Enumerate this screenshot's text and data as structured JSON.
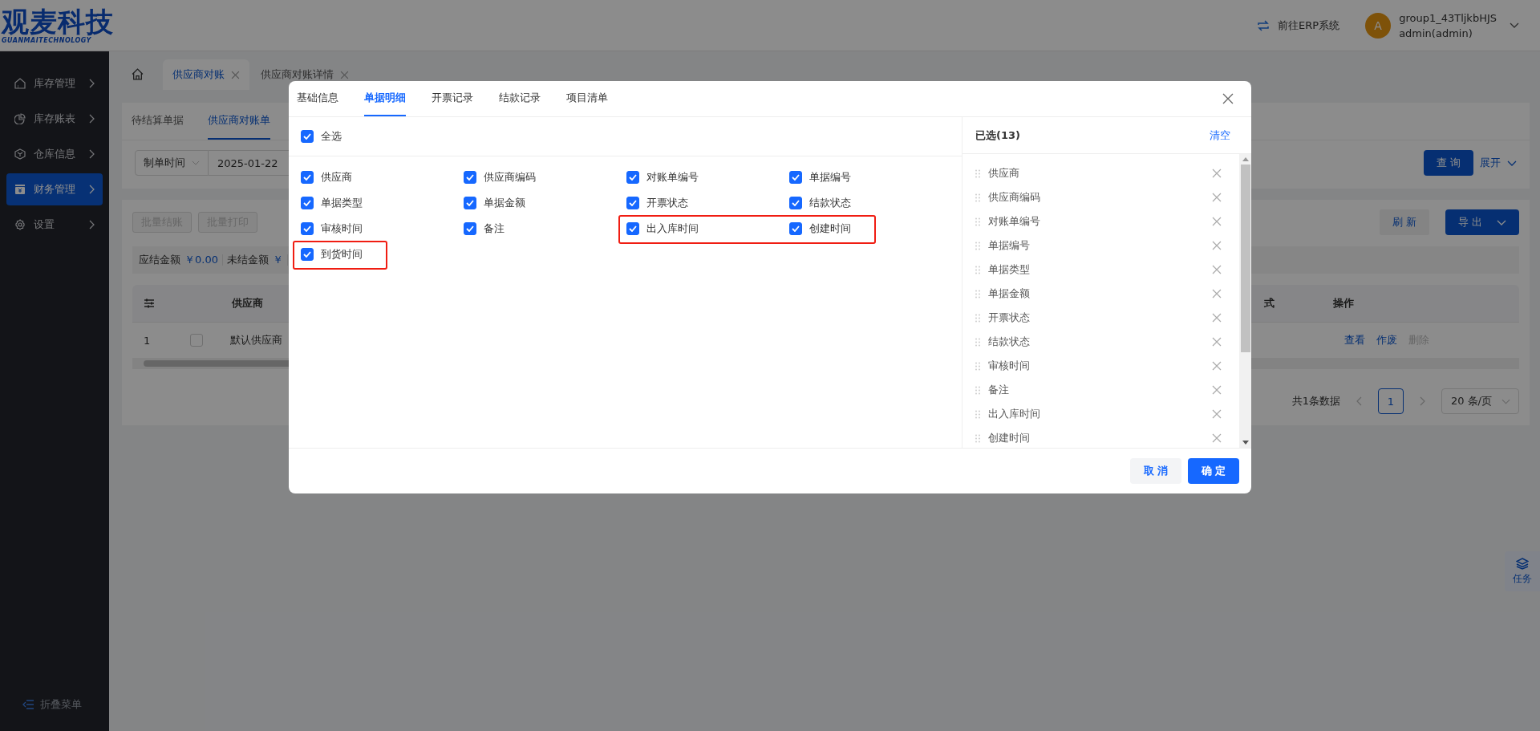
{
  "header": {
    "logo_title": "观麦科技",
    "logo_subtitle": "GUANMAITECHNOLOGY",
    "erp_link": "前往ERP系统",
    "user": {
      "avatar": "A",
      "name": "group1_43TljkbHJS",
      "role": "admin(admin)"
    }
  },
  "sidebar": {
    "items": [
      {
        "label": "库存管理",
        "selected": false
      },
      {
        "label": "库存账表",
        "selected": false
      },
      {
        "label": "仓库信息",
        "selected": false
      },
      {
        "label": "财务管理",
        "selected": true
      },
      {
        "label": "设置",
        "selected": false
      }
    ],
    "collapse": "折叠菜单"
  },
  "page_tabs": [
    {
      "label": "供应商对账",
      "selected": true
    },
    {
      "label": "供应商对账详情",
      "selected": false
    }
  ],
  "sub_tabs": [
    {
      "label": "待结算单据",
      "selected": false
    },
    {
      "label": "供应商对账单",
      "selected": true
    }
  ],
  "filter": {
    "field": "制单时间",
    "date": "2025-01-22",
    "query_button": "查 询",
    "expand": "展开"
  },
  "toolbar": {
    "buttons": [
      {
        "label": "批量结账",
        "disabled": true
      },
      {
        "label": "批量打印",
        "disabled": true
      }
    ],
    "refresh": "刷 新",
    "export": "导 出"
  },
  "summary": [
    {
      "label": "应结金额",
      "value": "￥0.00"
    },
    {
      "label": "未结金额",
      "value": "￥"
    }
  ],
  "table": {
    "columns": [
      "供应商",
      "式",
      "操作"
    ],
    "rows": [
      {
        "index": "1",
        "checked": false,
        "supplier": "默认供应商",
        "actions": [
          {
            "label": "查看",
            "disabled": false
          },
          {
            "label": "作废",
            "disabled": false
          },
          {
            "label": "删除",
            "disabled": true
          }
        ]
      }
    ]
  },
  "pagination": {
    "total": "共1条数据",
    "pages": [
      {
        "label": "1",
        "selected": true
      }
    ],
    "page_size": "20 条/页"
  },
  "float_button": "任务",
  "dialog": {
    "tabs": [
      {
        "label": "基础信息",
        "selected": false
      },
      {
        "label": "单据明细",
        "selected": true
      },
      {
        "label": "开票记录",
        "selected": false
      },
      {
        "label": "结款记录",
        "selected": false
      },
      {
        "label": "项目清单",
        "selected": false
      }
    ],
    "select_all": {
      "label": "全选",
      "checked": true
    },
    "options": [
      {
        "label": "供应商",
        "checked": true,
        "highlighted": false
      },
      {
        "label": "供应商编码",
        "checked": true,
        "highlighted": false
      },
      {
        "label": "对账单编号",
        "checked": true,
        "highlighted": false
      },
      {
        "label": "单据编号",
        "checked": true,
        "highlighted": false
      },
      {
        "label": "单据类型",
        "checked": true,
        "highlighted": false
      },
      {
        "label": "单据金额",
        "checked": true,
        "highlighted": false
      },
      {
        "label": "开票状态",
        "checked": true,
        "highlighted": false
      },
      {
        "label": "结款状态",
        "checked": true,
        "highlighted": false
      },
      {
        "label": "审核时间",
        "checked": true,
        "highlighted": false
      },
      {
        "label": "备注",
        "checked": true,
        "highlighted": false
      },
      {
        "label": "出入库时间",
        "checked": true,
        "highlighted": true
      },
      {
        "label": "创建时间",
        "checked": true,
        "highlighted": true
      },
      {
        "label": "到货时间",
        "checked": true,
        "highlighted": true
      }
    ],
    "selected_panel": {
      "title": "已选(13)",
      "clear": "清空",
      "items": [
        "供应商",
        "供应商编码",
        "对账单编号",
        "单据编号",
        "单据类型",
        "单据金额",
        "开票状态",
        "结款状态",
        "审核时间",
        "备注",
        "出入库时间",
        "创建时间"
      ]
    },
    "cancel": "取 消",
    "ok": "确 定"
  }
}
